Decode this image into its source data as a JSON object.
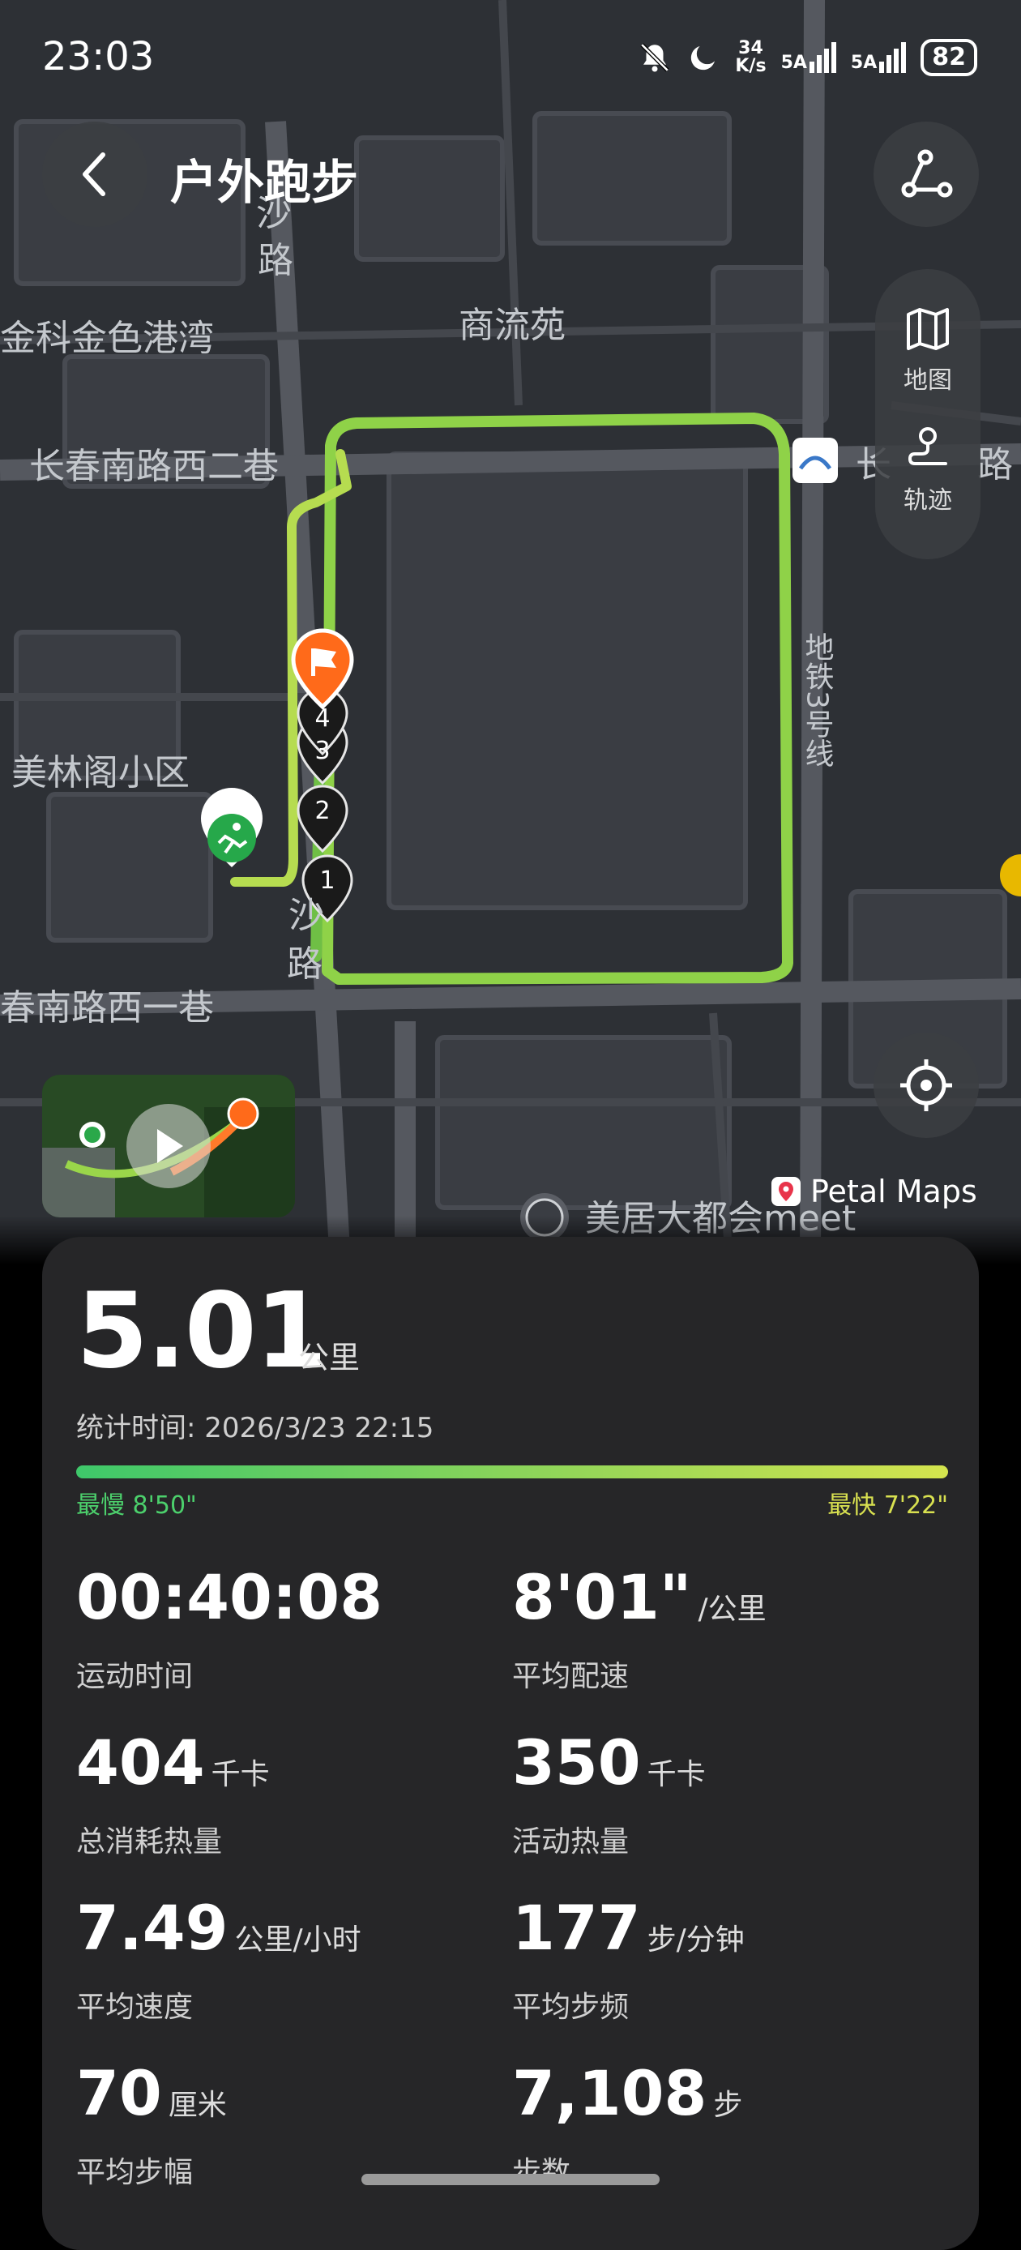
{
  "status_bar": {
    "time": "23:03",
    "net_speed_top": "34",
    "net_speed_bottom": "K/s",
    "sim1": "5A",
    "sim2": "5A",
    "battery": "82"
  },
  "header": {
    "title": "户外跑步",
    "back_icon": "chevron-left-icon",
    "share_icon": "route-share-icon"
  },
  "side_panel": {
    "map_label": "地图",
    "track_label": "轨迹"
  },
  "map": {
    "labels": {
      "road_sha1": "沙",
      "road_lu1": "路",
      "place_jinke": "金科金色港湾",
      "place_shangliu": "商流苑",
      "road_changchun2": "长春南路西二巷",
      "road_chang_right": "长",
      "road_lu_right": "路",
      "place_meilin": "美林阁小区",
      "road_sha2": "沙",
      "road_lu2": "路",
      "road_changchun1": "春南路西一巷",
      "metro_line": "地铁3号线",
      "place_meiju": "美居大都会meet",
      "route_marker_1": "1",
      "route_marker_2": "2",
      "route_marker_3": "3",
      "route_marker_4": "4"
    },
    "attribution": "Petal Maps",
    "route_color": "#9ad64a"
  },
  "summary": {
    "distance_value": "5.01",
    "distance_unit": "公里",
    "stat_time_label": "统计时间: ",
    "stat_time_value": "2026/3/23 22:15",
    "pace_slowest": "最慢 8'50\"",
    "pace_fastest": "最快 7'22\""
  },
  "metrics": {
    "duration": {
      "value": "00:40:08",
      "unit": "",
      "label": "运动时间"
    },
    "avg_pace": {
      "value": "8'01\"",
      "unit": "/公里",
      "label": "平均配速"
    },
    "total_calories": {
      "value": "404",
      "unit": "千卡",
      "label": "总消耗热量"
    },
    "active_calories": {
      "value": "350",
      "unit": "千卡",
      "label": "活动热量"
    },
    "avg_speed": {
      "value": "7.49",
      "unit": "公里/小时",
      "label": "平均速度"
    },
    "avg_cadence": {
      "value": "177",
      "unit": "步/分钟",
      "label": "平均步频"
    },
    "avg_stride": {
      "value": "70",
      "unit": "厘米",
      "label": "平均步幅"
    },
    "steps": {
      "value": "7,108",
      "unit": "步",
      "label": "步数"
    }
  }
}
